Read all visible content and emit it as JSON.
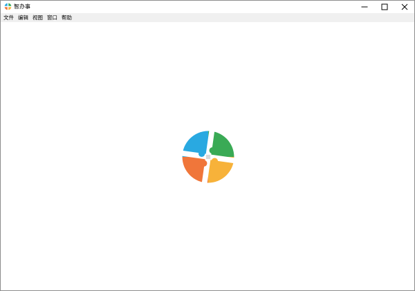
{
  "window": {
    "title": "智办事",
    "app_icon": "app-logo-icon",
    "controls": {
      "minimize_icon": "minimize-icon",
      "maximize_icon": "maximize-icon",
      "close_icon": "close-icon"
    }
  },
  "menubar": {
    "items": [
      {
        "label": "文件"
      },
      {
        "label": "编辑"
      },
      {
        "label": "视图"
      },
      {
        "label": "窗口"
      },
      {
        "label": "帮助"
      }
    ]
  },
  "content": {
    "splash_logo": "app-logo-icon"
  },
  "colors": {
    "logo_blue": "#29a9e1",
    "logo_green": "#3aaa55",
    "logo_orange": "#f0763a",
    "logo_yellow": "#f7b23a",
    "menubar_bg": "#f0f0f0",
    "window_border": "#8c8c8c"
  }
}
